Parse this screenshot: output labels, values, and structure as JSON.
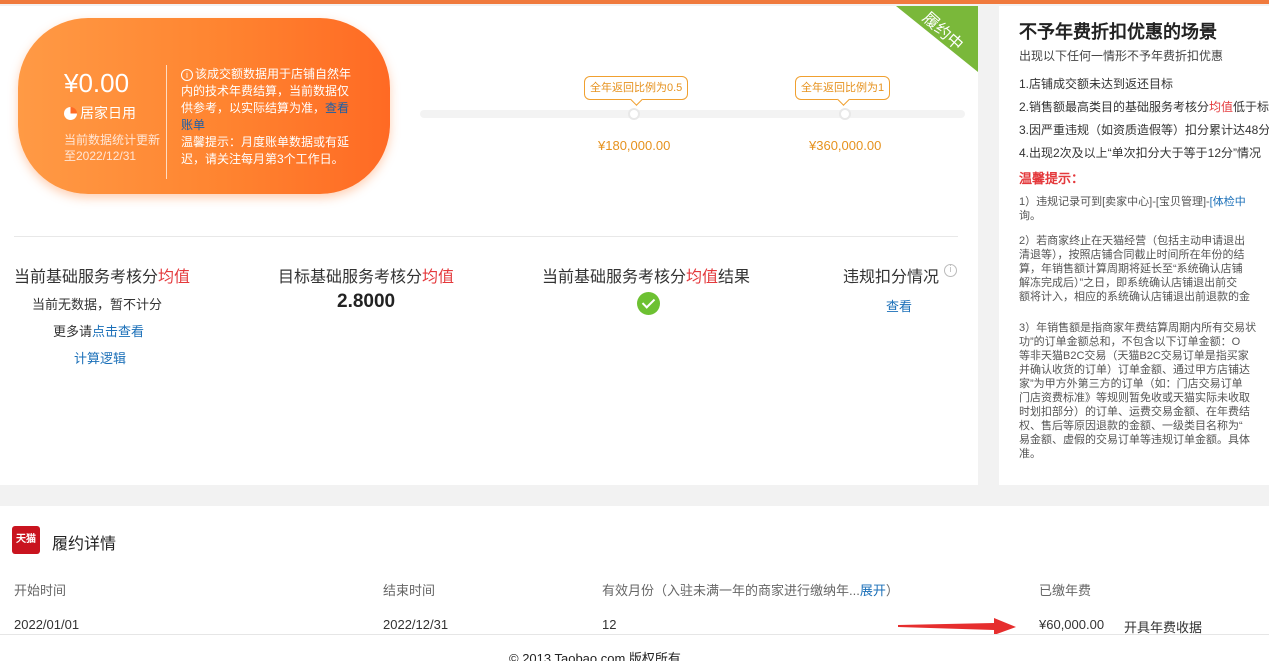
{
  "summary": {
    "amount": "¥0.00",
    "shop_name": "居家日用",
    "update_text": "当前数据统计更新至2022/12/31",
    "note_part1": "该成交额数据用于店铺自然年内的技术年费结算，当前数据仅供参考，以实际结算为准，",
    "note_link": "查看账单",
    "note_tip": "温馨提示：月度账单数据或有延迟，请关注每月第3个工作日。",
    "ribbon": "履约中"
  },
  "progress": {
    "milestone1_label": "全年返回比例为0.5",
    "milestone1_value": "¥180,000.00",
    "milestone2_label": "全年返回比例为1",
    "milestone2_value": "¥360,000.00"
  },
  "stats": {
    "current_title_a": "当前基础服务考核分",
    "current_title_b": "均值",
    "current_nodata": "当前无数据，暂不计分",
    "current_more_a": "更多请",
    "current_more_link": "点击查看",
    "current_logic": "计算逻辑",
    "target_title_a": "目标基础服务考核分",
    "target_title_b": "均值",
    "target_value": "2.8000",
    "result_title_a": "当前基础服务考核分",
    "result_title_b": "均值",
    "result_title_c": "结果",
    "violation_title": "违规扣分情况",
    "violation_link": "查看"
  },
  "side": {
    "title": "不予年费折扣优惠的场景",
    "subtitle": "出现以下任何一情形不予年费折扣优惠",
    "item1": "1.店铺成交额未达到返还目标",
    "item2_a": "2.销售额最高类目的基础服务考核分",
    "item2_b": "均值",
    "item2_c": "低于标",
    "item3": "3.因严重违规（如资质造假等）扣分累计达48分",
    "item4": "4.出现2次及以上“单次扣分大于等于12分”情况",
    "tip": "温馨提示：",
    "para1_l1_a": "1）违规记录可到[卖家中心]-[宝贝管理]-",
    "para1_l1_b": "[体检中",
    "para1_l2": "询。",
    "para2_l1": "2）若商家终止在天猫经营（包括主动申请退出",
    "para2_l2": "清退等），按照店铺合同截止时间所在年份的结",
    "para2_l3": "算，年销售额计算周期将延长至“系统确认店铺",
    "para2_l4": "解冻完成后）”之日，即系统确认店铺退出前交",
    "para2_l5": "额将计入，相应的系统确认店铺退出前退款的金",
    "para3_l1": "3）年销售额是指商家年费结算周期内所有交易状",
    "para3_l2": "功”的订单金额总和，不包含以下订单金额：O",
    "para3_l3": "等非天猫B2C交易（天猫B2C交易订单是指买家",
    "para3_l4": "并确认收货的订单）订单金额、通过甲方店铺达",
    "para3_l5": "家”为甲方外第三方的订单（如：门店交易订单",
    "para3_l6": "门店资费标准》等规则暂免收或天猫实际未收取",
    "para3_l7": "时划扣部分）的订单、运费交易金额、在年费结",
    "para3_l8": "权、售后等原因退款的金额、一级类目名称为“",
    "para3_l9": "易金额、虚假的交易订单等违规订单金额。具体",
    "para3_l10": "准。"
  },
  "detail": {
    "logo_text": "天猫",
    "title": "履约详情",
    "col_start": "开始时间",
    "col_end": "结束时间",
    "col_months": "有效月份（入驻未满一年的商家进行缴纳年...",
    "col_months_link": "展开",
    "col_months_close": "）",
    "col_paid": "已缴年费",
    "val_start": "2022/01/01",
    "val_end": "2022/12/31",
    "val_months": "12",
    "val_paid": "¥60,000.00",
    "receipt_link": "开具年费收据"
  },
  "footer": {
    "copyright": "© 2013 Taobao.com 版权所有"
  },
  "colors": {
    "accent_orange": "#ff8430",
    "ribbon_green": "#7ab83a",
    "link_blue": "#1a6fb8",
    "emphasis_red": "#e4393c"
  }
}
